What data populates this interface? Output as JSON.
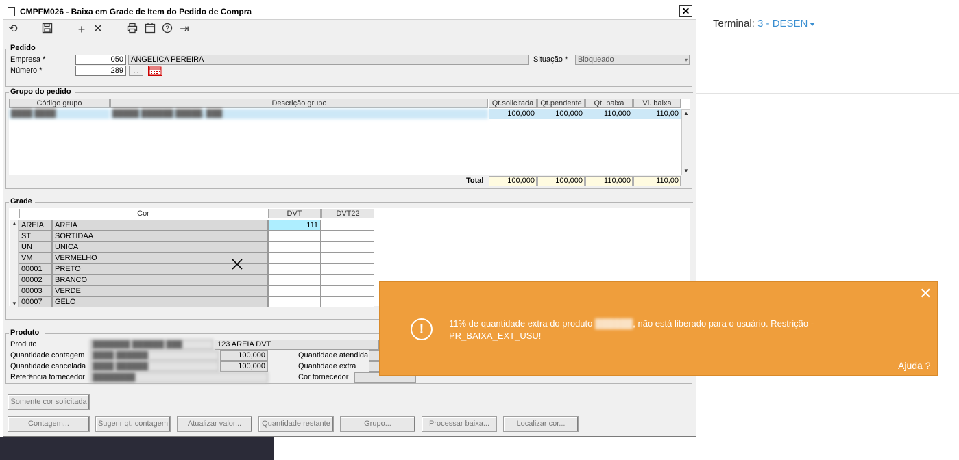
{
  "window": {
    "title": "CMPFM026 - Baixa em Grade de Item do Pedido de Compra",
    "close_label": "✕"
  },
  "toolbar": {
    "icons": [
      "undo-icon",
      "save-icon",
      "add-icon",
      "delete-icon",
      "print-icon",
      "calendar-icon",
      "help-icon",
      "exit-icon"
    ],
    "glyphs": [
      "⟲",
      "🖫",
      "+",
      "✕",
      "🖶",
      "▦",
      "?",
      "⇥"
    ]
  },
  "pedido": {
    "label": "Pedido",
    "empresa_label": "Empresa *",
    "empresa_value": "050",
    "empresa_name": "ANGELICA PEREIRA",
    "numero_label": "Número *",
    "numero_value": "289",
    "situacao_label": "Situação *",
    "situacao_value": "Bloqueado"
  },
  "grupo": {
    "label": "Grupo do pedido",
    "headers": [
      "Código grupo",
      "Descrição grupo",
      "Qt.solicitada",
      "Qt.pendente",
      "Qt. baixa",
      "Vl. baixa"
    ],
    "row": {
      "codigo": "████ ████",
      "descricao": "█████ ██████ █████, ███",
      "qt_solicitada": "100,000",
      "qt_pendente": "100,000",
      "qt_baixa": "110,000",
      "vl_baixa": "110,00"
    },
    "total_label": "Total",
    "totals": [
      "100,000",
      "100,000",
      "110,000",
      "110,00"
    ]
  },
  "grade": {
    "label": "Grade",
    "headers": {
      "cor": "Cor",
      "dvt": "DVT",
      "dvt22": "DVT22"
    },
    "rows": [
      {
        "code": "AREIA",
        "desc": "AREIA",
        "dvt": "111",
        "dvt22": ""
      },
      {
        "code": "ST",
        "desc": "SORTIDAA",
        "dvt": "",
        "dvt22": ""
      },
      {
        "code": "UN",
        "desc": "UNICA",
        "dvt": "",
        "dvt22": ""
      },
      {
        "code": "VM",
        "desc": "VERMELHO",
        "dvt": "",
        "dvt22": ""
      },
      {
        "code": "00001",
        "desc": "PRETO",
        "dvt": "",
        "dvt22": ""
      },
      {
        "code": "00002",
        "desc": "BRANCO",
        "dvt": "",
        "dvt22": ""
      },
      {
        "code": "00003",
        "desc": "VERDE",
        "dvt": "",
        "dvt22": ""
      },
      {
        "code": "00007",
        "desc": "GELO",
        "dvt": "",
        "dvt22": ""
      }
    ]
  },
  "produto": {
    "label": "Produto",
    "produto_label": "Produto",
    "produto_value": "123 AREIA DVT",
    "qt_contagem_label": "Quantidade contagem",
    "qt_contagem_value": "100,000",
    "qt_cancelada_label": "Quantidade cancelada",
    "qt_cancelada_value": "100,000",
    "ref_fornecedor_label": "Referência fornecedor",
    "qt_atendida_label": "Quantidade atendida",
    "qt_extra_label": "Quantidade extra",
    "cor_fornecedor_label": "Cor fornecedor"
  },
  "buttons": {
    "somente_cor": "Somente cor solicitada",
    "contagem": "Contagem...",
    "sugerir": "Sugerir qt. contagem",
    "atualizar": "Atualizar valor...",
    "restante": "Quantidade restante",
    "grupo": "Grupo...",
    "processar": "Processar baixa...",
    "localizar": "Localizar cor..."
  },
  "terminal": {
    "label": "Terminal:",
    "value": "3 - DESEN"
  },
  "toast": {
    "message_pre": "11% de quantidade extra do produto",
    "message_hidden": "██████",
    "message_post": ", não está liberado para o usuário. Restrição - PR_BAIXA_EXT_USU!",
    "help_label": "Ajuda ?",
    "close_label": "✕",
    "icon_label": "!",
    "color": "#ef9e3c"
  }
}
